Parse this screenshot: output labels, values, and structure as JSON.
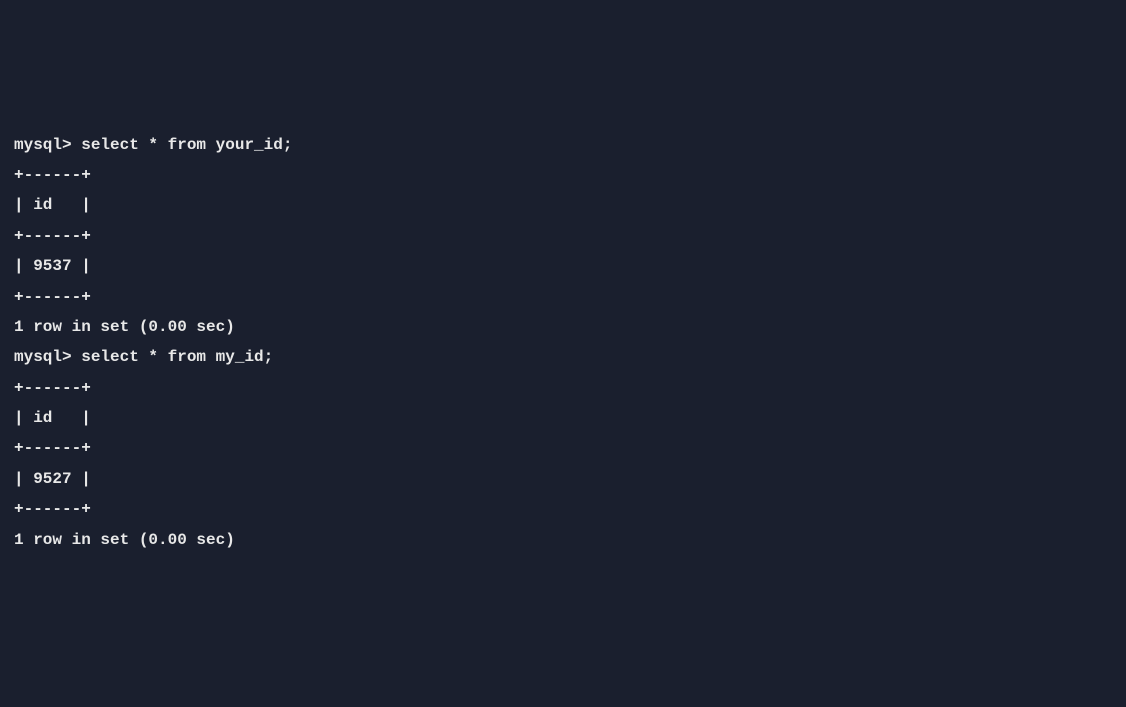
{
  "terminal": {
    "lines": [
      "mysql> select * from your_id;",
      "+------+",
      "| id   |",
      "+------+",
      "| 9537 |",
      "+------+",
      "1 row in set (0.00 sec)",
      "",
      "mysql> select * from my_id;",
      "+------+",
      "| id   |",
      "+------+",
      "| 9527 |",
      "+------+",
      "1 row in set (0.00 sec)"
    ]
  },
  "chart_data": {
    "type": "table",
    "queries": [
      {
        "prompt": "mysql>",
        "sql": "select * from your_id;",
        "columns": [
          "id"
        ],
        "rows": [
          [
            9537
          ]
        ],
        "row_count": 1,
        "elapsed_sec": 0.0
      },
      {
        "prompt": "mysql>",
        "sql": "select * from my_id;",
        "columns": [
          "id"
        ],
        "rows": [
          [
            9527
          ]
        ],
        "row_count": 1,
        "elapsed_sec": 0.0
      }
    ]
  }
}
